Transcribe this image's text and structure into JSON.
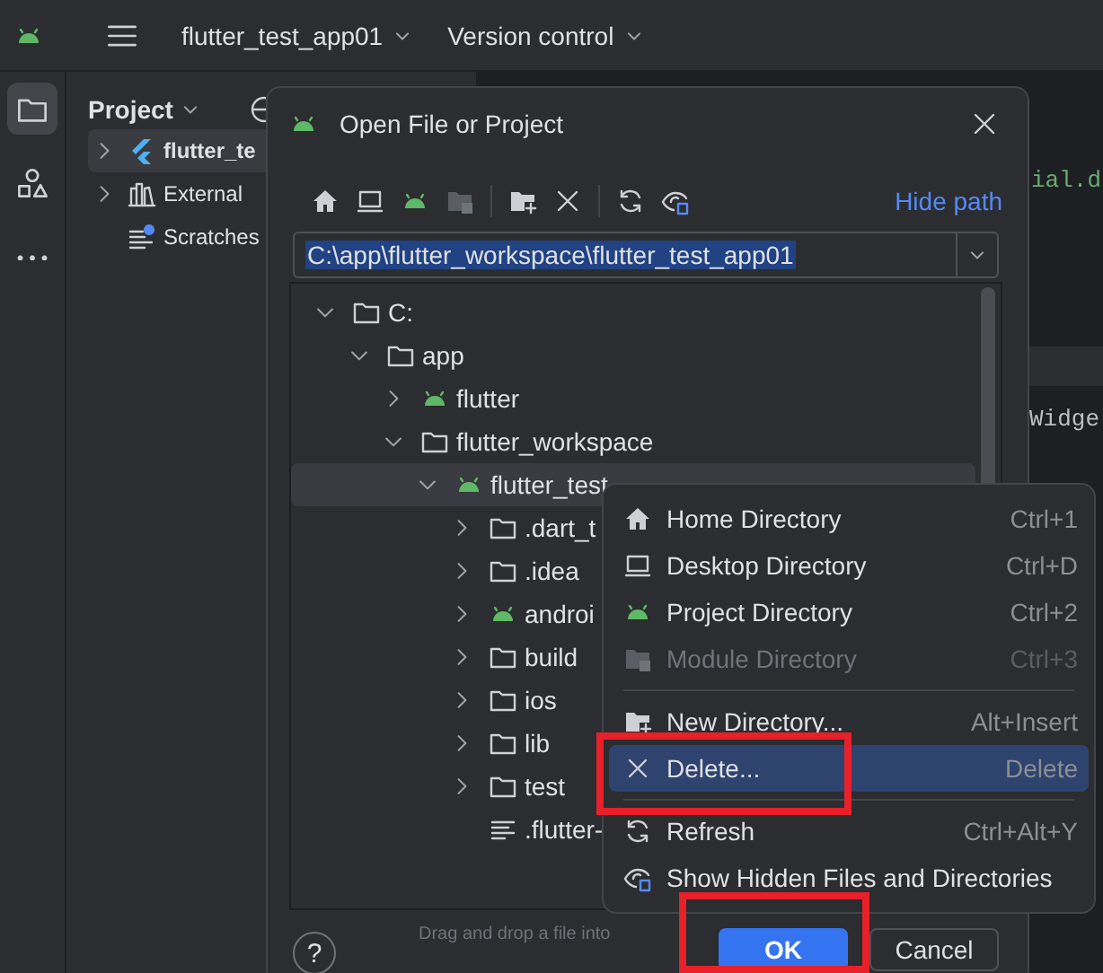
{
  "topbar": {
    "project": "flutter_test_app01",
    "vcs": "Version control"
  },
  "toolstrip": [
    {
      "selected": true
    },
    {
      "selected": false
    },
    {
      "selected": false
    }
  ],
  "project_panel": {
    "title": "Project",
    "tree": [
      {
        "label": "flutter_te",
        "kind": "logo",
        "expanded": false,
        "selected": true
      },
      {
        "label": "External",
        "kind": "books",
        "expanded": false,
        "selected": false
      },
      {
        "label": "Scratches",
        "kind": "notes",
        "selected": false
      }
    ]
  },
  "editor": {
    "lines": [
      "ial.d",
      "Widge"
    ]
  },
  "dialog": {
    "title": "Open File or Project",
    "hide_path": "Hide path",
    "path": "C:\\app\\flutter_workspace\\flutter_test_app01",
    "tree": [
      {
        "label": "C:",
        "kind": "folder",
        "expanded": true,
        "selected": false,
        "children": [
          {
            "label": "app",
            "kind": "folder",
            "expanded": true,
            "selected": false,
            "children": [
              {
                "label": "flutter",
                "kind": "module",
                "expanded": false,
                "selected": false
              },
              {
                "label": "flutter_workspace",
                "kind": "folder",
                "expanded": true,
                "selected": false,
                "children": [
                  {
                    "label": "flutter_test",
                    "kind": "module",
                    "expanded": true,
                    "selected": true,
                    "children": [
                      {
                        "label": ".dart_t",
                        "kind": "folder",
                        "expanded": false,
                        "selected": false
                      },
                      {
                        "label": ".idea",
                        "kind": "folder",
                        "expanded": false,
                        "selected": false
                      },
                      {
                        "label": "androi",
                        "kind": "module",
                        "expanded": false,
                        "selected": false
                      },
                      {
                        "label": "build",
                        "kind": "folder",
                        "expanded": false,
                        "selected": false
                      },
                      {
                        "label": "ios",
                        "kind": "folder",
                        "expanded": false,
                        "selected": false
                      },
                      {
                        "label": "lib",
                        "kind": "folder",
                        "expanded": false,
                        "selected": false
                      },
                      {
                        "label": "test",
                        "kind": "folder",
                        "expanded": false,
                        "selected": false
                      },
                      {
                        "label": ".flutter-",
                        "kind": "file",
                        "selected": false
                      }
                    ]
                  }
                ]
              }
            ]
          }
        ]
      }
    ],
    "hint": "Drag and drop a file into",
    "help": "?",
    "ok": "OK",
    "cancel": "Cancel"
  },
  "context_menu": {
    "groups": [
      {
        "items": [
          {
            "label": "Home Directory",
            "shortcut": "Ctrl+1",
            "disabled": false,
            "selected": false
          },
          {
            "label": "Desktop Directory",
            "shortcut": "Ctrl+D",
            "disabled": false,
            "selected": false
          },
          {
            "label": "Project Directory",
            "shortcut": "Ctrl+2",
            "disabled": false,
            "selected": false
          },
          {
            "label": "Module Directory",
            "shortcut": "Ctrl+3",
            "disabled": true,
            "selected": false
          }
        ]
      },
      {
        "items": [
          {
            "label": "New Directory...",
            "shortcut": "Alt+Insert",
            "disabled": false,
            "selected": false
          },
          {
            "label": "Delete...",
            "shortcut": "Delete",
            "disabled": false,
            "selected": true
          }
        ]
      },
      {
        "items": [
          {
            "label": "Refresh",
            "shortcut": "Ctrl+Alt+Y",
            "disabled": false,
            "selected": false
          },
          {
            "label": "Show Hidden Files and Directories",
            "disabled": false,
            "selected": false
          }
        ]
      }
    ]
  },
  "annotations": [
    {
      "kind": "frame"
    },
    {
      "kind": "frame"
    }
  ]
}
